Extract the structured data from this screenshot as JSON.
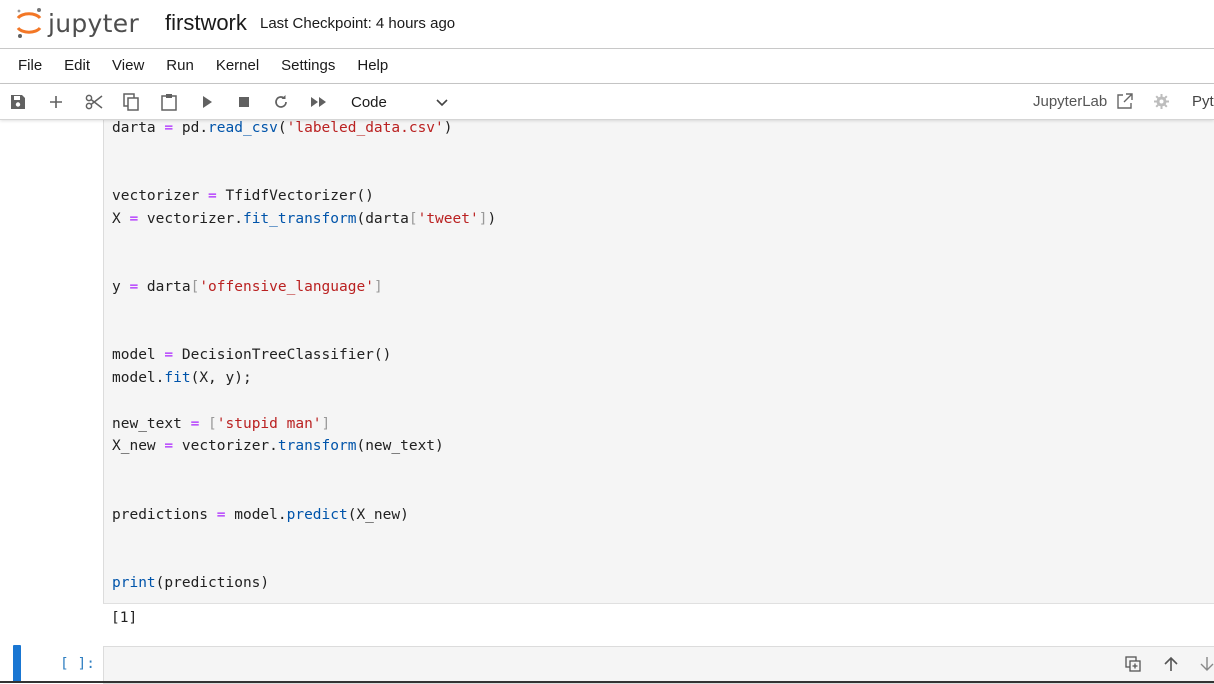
{
  "header": {
    "logo_text": "jupyter",
    "notebook_title": "firstwork",
    "checkpoint": "Last Checkpoint: 4 hours ago"
  },
  "menu": [
    "File",
    "Edit",
    "View",
    "Run",
    "Kernel",
    "Settings",
    "Help"
  ],
  "toolbar": {
    "cell_type": "Code",
    "jupyterlab_label": "JupyterLab",
    "kernel_name": "Pyt",
    "icons": [
      "save-icon",
      "add-icon",
      "cut-icon",
      "copy-icon",
      "paste-icon",
      "run-icon",
      "stop-icon",
      "restart-icon",
      "fast-forward-icon"
    ]
  },
  "cell": {
    "lines": [
      "darta = pd.read_csv('labeled_data.csv')",
      "vectorizer = TfidfVectorizer()",
      "X = vectorizer.fit_transform(darta['tweet'])",
      "y = darta['offensive_language']",
      "model = DecisionTreeClassifier()",
      "model.fit(X, y);",
      "new_text = ['stupid man']",
      "X_new = vectorizer.transform(new_text)",
      "predictions = model.predict(X_new)",
      "print(predictions)"
    ],
    "output": "[1]"
  },
  "empty_cell": {
    "prompt": "[ ]:"
  },
  "colors": {
    "accent": "#1976d2",
    "logo_orange": "#f37726",
    "cell_bg": "#f5f5f5",
    "keyword_op": "#aa22ff",
    "string": "#ba2121",
    "function": "#0054aa"
  }
}
